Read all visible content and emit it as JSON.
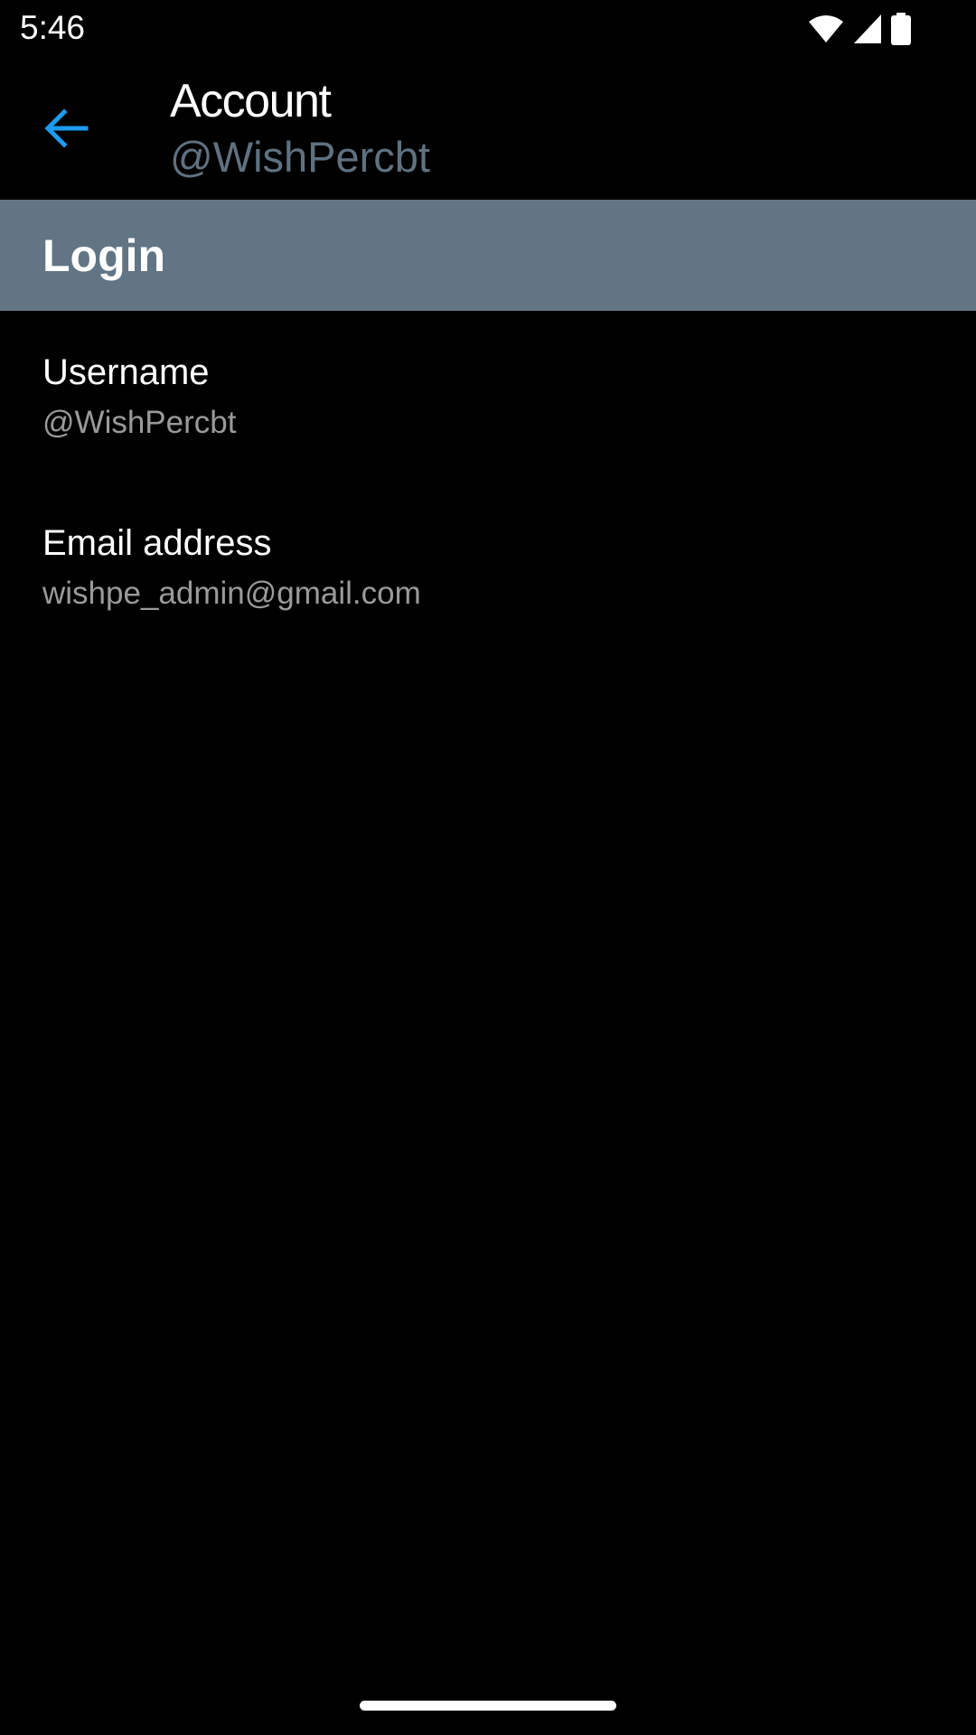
{
  "status_bar": {
    "time": "5:46",
    "icons": [
      "wifi-icon",
      "cellular-signal-icon",
      "battery-icon"
    ]
  },
  "app_bar": {
    "back_icon": "arrow-left-icon",
    "title": "Account",
    "subtitle": "@WishPercbt"
  },
  "section": {
    "title": "Login"
  },
  "settings": [
    {
      "label": "Username",
      "value": "@WishPercbt"
    },
    {
      "label": "Email address",
      "value": "wishpe_admin@gmail.com"
    }
  ],
  "colors": {
    "background": "#000000",
    "accent": "#1d9bf0",
    "section_header": "#617585",
    "subtitle": "#5f7180",
    "secondary_text": "#9a9a9a"
  }
}
